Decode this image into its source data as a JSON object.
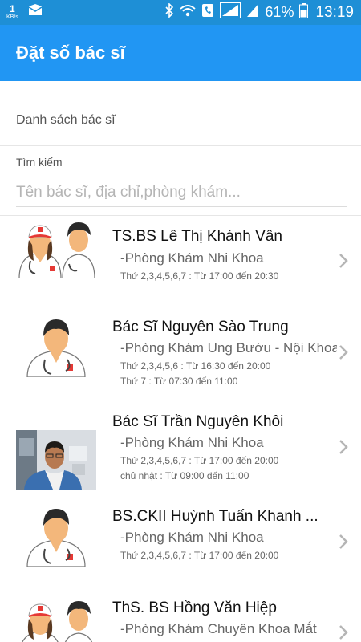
{
  "status_bar": {
    "speed_value": "1",
    "speed_unit": "KB/s",
    "battery": "61%",
    "time": "13:19",
    "icons": [
      "mail-icon",
      "bluetooth-icon",
      "wifi-call-icon",
      "phone-icon",
      "signal-icon",
      "battery-icon"
    ]
  },
  "header": {
    "title": "Đặt số bác sĩ"
  },
  "section": {
    "title": "Danh sách bác sĩ"
  },
  "search": {
    "label": "Tìm kiếm",
    "placeholder": "Tên bác sĩ, địa chỉ,phòng khám..."
  },
  "doctors": [
    {
      "name": "TS.BS Lê Thị Khánh Vân",
      "clinic": "-Phòng Khám Nhi Khoa",
      "hours": [
        "Thứ 2,3,4,5,6,7 : Từ 17:00 đến 20:30"
      ],
      "avatar": "doctors-group-icon"
    },
    {
      "name": "Bác Sĩ Nguyễn Sào Trung",
      "clinic": "-Phòng Khám Ung Bướu - Nội Khoa",
      "hours": [
        "Thứ 2,3,4,5,6 : Từ 16:30 đến 20:00",
        "Thứ 7 : Từ 07:30 đến 11:00"
      ],
      "avatar": "doctor-icon"
    },
    {
      "name": "Bác Sĩ Trần Nguyên Khôi",
      "clinic": "-Phòng Khám Nhi Khoa",
      "hours": [
        "Thứ 2,3,4,5,6,7 : Từ 17:00 đến 20:00",
        "chủ nhật : Từ 09:00 đến 11:00"
      ],
      "avatar": "doctor-photo"
    },
    {
      "name": "BS.CKII Huỳnh Tuấn Khanh ...",
      "clinic": "-Phòng Khám Nhi Khoa",
      "hours": [
        "Thứ 2,3,4,5,6,7 : Từ 17:00 đến 20:00"
      ],
      "avatar": "doctor-icon"
    },
    {
      "name": "ThS. BS Hồng Văn Hiệp",
      "clinic": "-Phòng Khám Chuyên Khoa Mắt",
      "hours": [],
      "avatar": "doctors-group-icon"
    }
  ]
}
